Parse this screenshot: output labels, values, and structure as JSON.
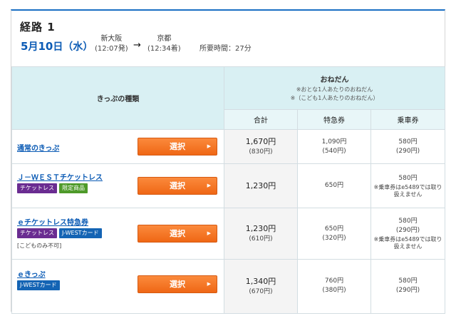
{
  "route": {
    "title": "経路 1",
    "date_month": "5",
    "date_day": "10",
    "date_weekday": "水"
  },
  "departure": {
    "station": "新大阪",
    "time": "(12:07発)"
  },
  "arrival": {
    "station": "京都",
    "time": "(12:34着)"
  },
  "arrow": "→",
  "duration": "所要時間：27分",
  "table": {
    "ticket_type_header": "きっぷの種類",
    "fare_header": "おねだん",
    "fare_note1": "※おとな1人あたりのおねだん",
    "fare_note2": "※（こども1人あたりのおねだん）",
    "col_total": "合計",
    "col_express": "特急券",
    "col_base": "乗車券",
    "select_label": "選択",
    "rows": [
      {
        "name": "通常のきっぷ",
        "total": "1,670円",
        "total_child": "(830円)",
        "express": "1,090円",
        "express_child": "(540円)",
        "base": "580円",
        "base_child": "(290円)"
      },
      {
        "name": "Ｊ－ＷＥＳＴチケットレス",
        "badges": [
          "チケットレス",
          "限定商品"
        ],
        "total": "1,230円",
        "express": "650円",
        "base": "580円",
        "base_note": "※乗車券はe5489では取り扱えません"
      },
      {
        "name": "ｅチケットレス特急券",
        "badges": [
          "チケットレス",
          "J-WESTカード"
        ],
        "extra_note": "[こどものみ不可]",
        "total": "1,230円",
        "total_child": "(610円)",
        "express": "650円",
        "express_child": "(320円)",
        "base": "580円",
        "base_child": "(290円)",
        "base_note": "※乗車券はe5489では取り扱えません"
      },
      {
        "name": "ｅきっぷ",
        "badges": [
          "J-WESTカード"
        ],
        "total": "1,340円",
        "total_child": "(670円)",
        "express": "760円",
        "express_child": "(380円)",
        "base": "580円",
        "base_child": "(290円)"
      }
    ]
  },
  "colors": {
    "accent": "#0b5bb5",
    "select_button": "#f26f1c",
    "header_bg": "#d9f0f3"
  }
}
